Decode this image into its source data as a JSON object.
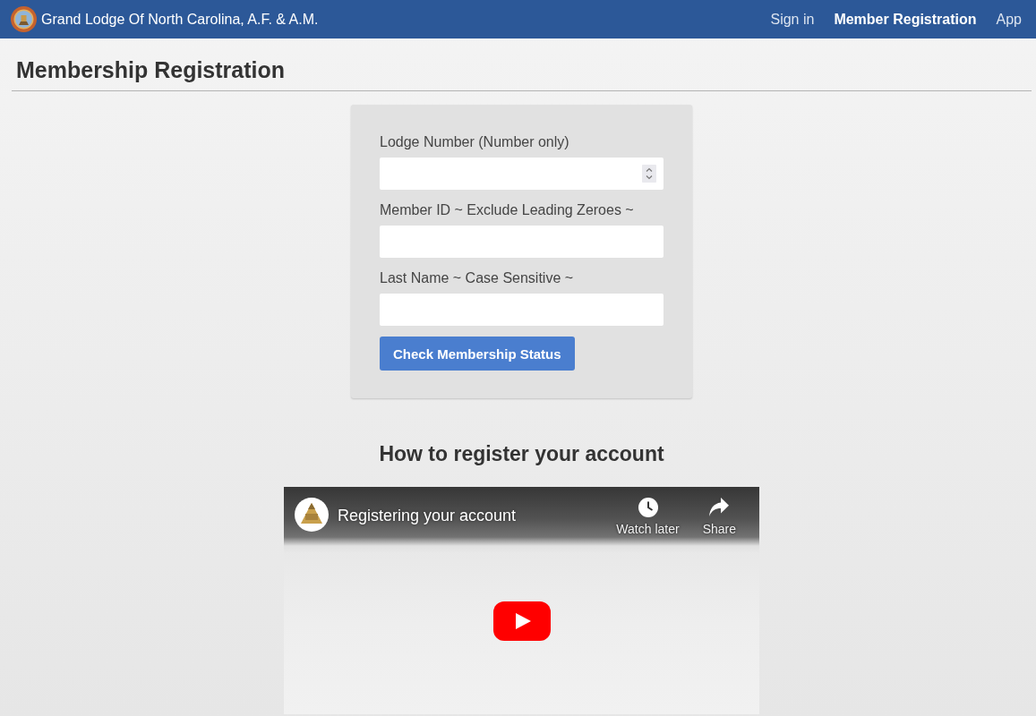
{
  "navbar": {
    "brand": "Grand Lodge Of North Carolina, A.F. & A.M.",
    "links": [
      {
        "label": "Sign in",
        "selected": false
      },
      {
        "label": "Member Registration",
        "selected": true
      },
      {
        "label": "App",
        "selected": false
      }
    ]
  },
  "page": {
    "title": "Membership Registration"
  },
  "form": {
    "fields": [
      {
        "label": "Lodge Number (Number only)",
        "kind": "number"
      },
      {
        "label": "Member ID ~ Exclude Leading Zeroes ~",
        "kind": "text"
      },
      {
        "label": "Last Name ~ Case Sensitive ~",
        "kind": "text"
      }
    ],
    "submit": "Check Membership Status"
  },
  "video_section": {
    "heading": "How to register your account",
    "video": {
      "title": "Registering your account",
      "actions": [
        {
          "label": "Watch later",
          "kind": "clock"
        },
        {
          "label": "Share",
          "kind": "share"
        }
      ]
    }
  }
}
